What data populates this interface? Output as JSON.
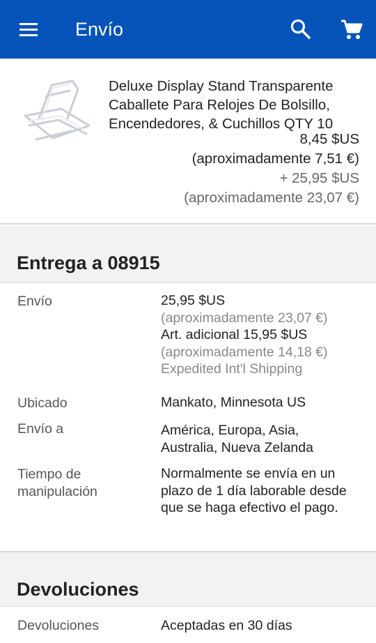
{
  "header": {
    "title": "Envío",
    "menu_icon": "menu-icon",
    "search_icon": "search-icon",
    "cart_icon": "cart-icon",
    "color": "#0654ba"
  },
  "item": {
    "title": "Deluxe Display Stand Transparente Caballete Para Relojes De Bolsillo, Encendedores, & Cuchillos QTY 10",
    "price": "8,45 $US",
    "price_approx": "(aproximadamente 7,51 €)",
    "shipping": "+ 25,95 $US",
    "shipping_approx": "(aproximadamente 23,07 €)"
  },
  "delivery": {
    "heading": "Entrega a 08915",
    "shipping_label": "Envío",
    "shipping_cost": "25,95 $US",
    "shipping_cost_approx": "(aproximadamente 23,07 €)",
    "additional": "Art. adicional 15,95 $US",
    "additional_approx": "(aproximadamente 14,18 €)",
    "service": "Expedited Int'l Shipping",
    "located_label": "Ubicado",
    "located_value": "Mankato, Minnesota US",
    "ships_to_label": "Envío a",
    "ships_to_value": "América, Europa, Asia, Australia, Nueva Zelanda",
    "handling_label": "Tiempo de manipulación",
    "handling_value": "Normalmente se envía en un plazo de 1 día laborable desde que se haga efectivo el pago."
  },
  "returns": {
    "heading": "Devoluciones",
    "label": "Devoluciones",
    "value": "Aceptadas en 30 días"
  }
}
